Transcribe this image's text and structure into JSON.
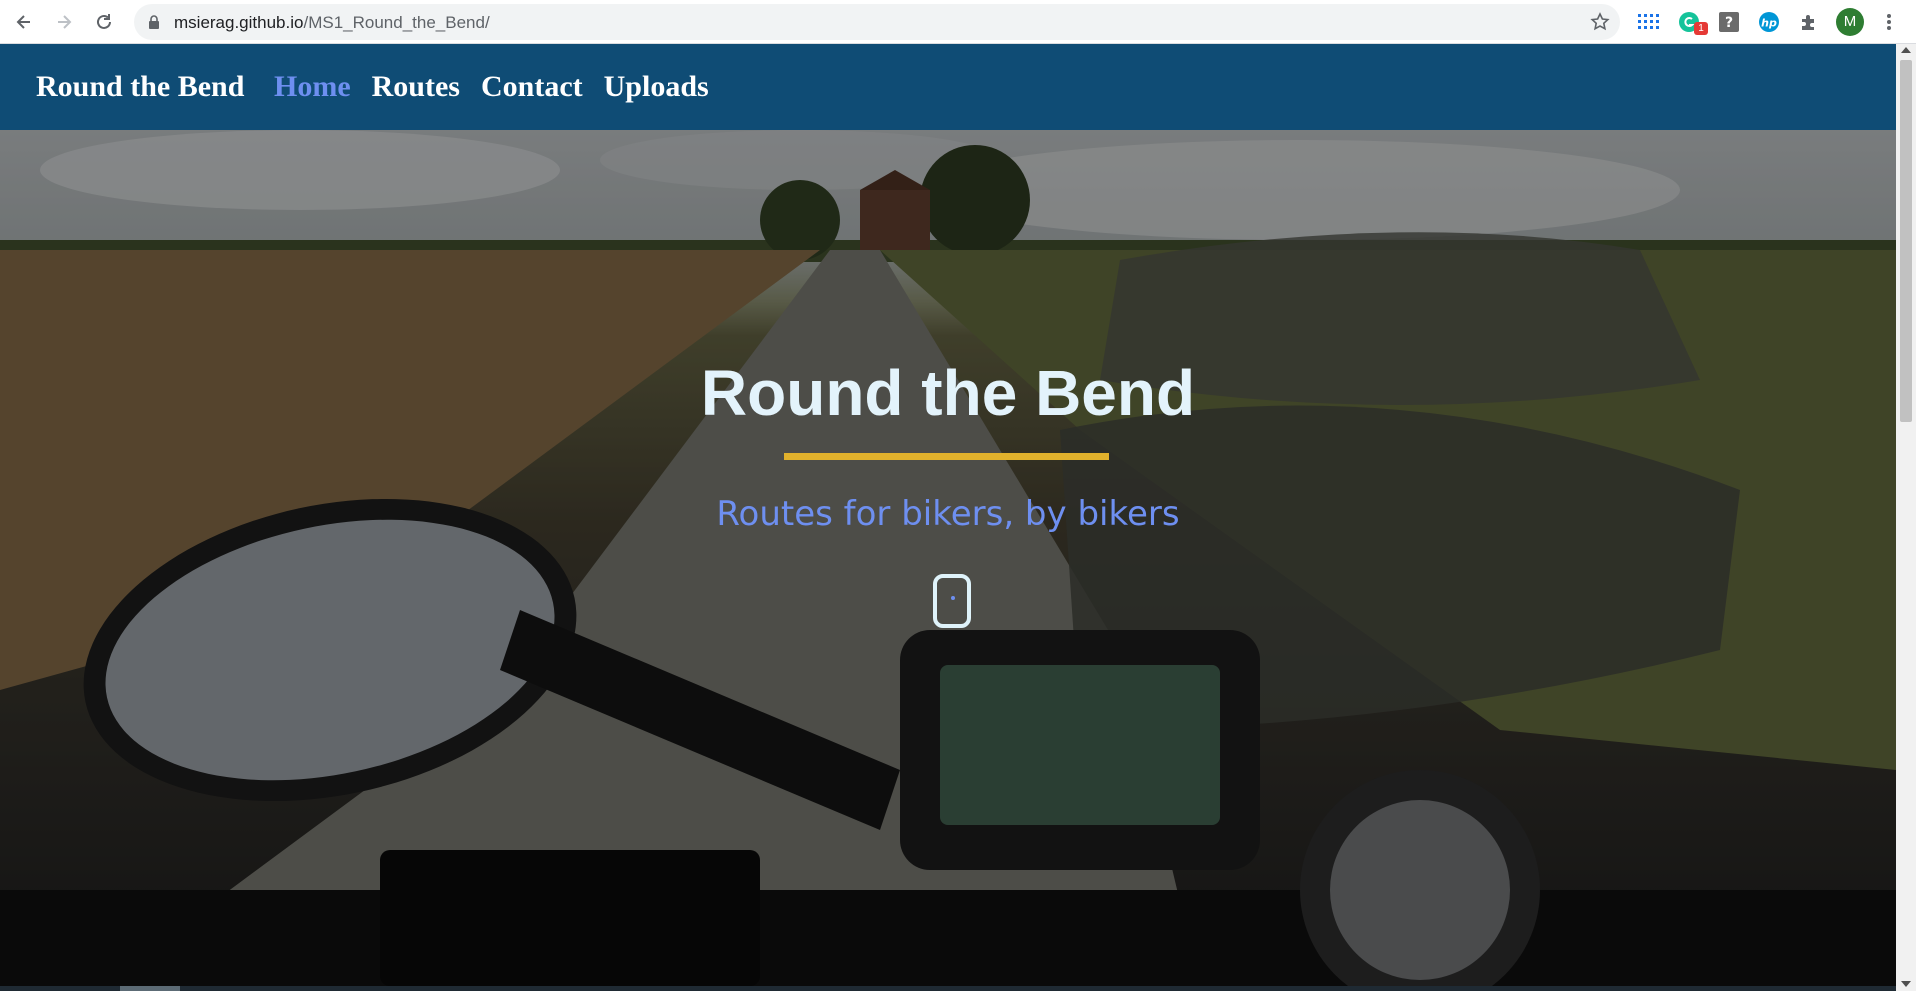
{
  "browser": {
    "url_host": "msierag.github.io",
    "url_path": "/MS1_Round_the_Bend/",
    "extension_badge": "1",
    "profile_initial": "M",
    "icons": [
      "back-icon",
      "forward-icon",
      "reload-icon",
      "lock-icon",
      "bookmark-star-icon",
      "apps-grid-icon",
      "grammarly-icon",
      "help-icon",
      "hp-icon",
      "extensions-icon",
      "menu-icon"
    ]
  },
  "nav": {
    "brand": "Round the Bend",
    "links": [
      "Home",
      "Routes",
      "Contact",
      "Uploads"
    ],
    "active": "Home"
  },
  "hero": {
    "title": "Round the Bend",
    "subtitle": "Routes for bikers, by bikers",
    "scroll_indicator": "mouse-scroll-icon"
  },
  "colors": {
    "navbar": "#0f4c75",
    "active_link": "#6e8ff0",
    "accent_rule": "#e1b12c",
    "hero_title": "#e3f3fb",
    "subtitle": "#6e8ff0"
  }
}
